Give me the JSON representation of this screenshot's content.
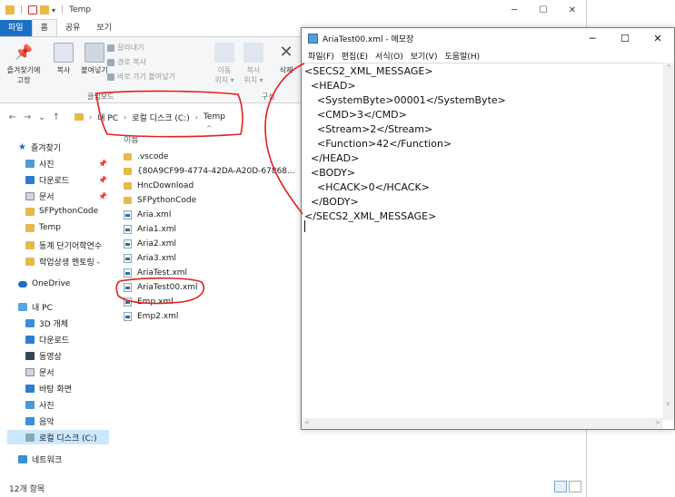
{
  "explorer": {
    "title": "Temp",
    "window_controls": {
      "minimize": "─",
      "maximize": "☐",
      "close": "✕"
    },
    "ribbon_tabs": [
      "파일",
      "홈",
      "공유",
      "보기"
    ],
    "ribbon": {
      "pin_label_1": "즐겨찾기에",
      "pin_label_2": "고정",
      "copy_label": "복사",
      "paste_label": "붙여넣기",
      "cut_label": "잘라내기",
      "copy_path_label": "경로 복사",
      "paste_shortcut_label": "바로 가기 붙여넣기",
      "move_label_1": "이동",
      "move_label_2": "위치 ▾",
      "copyto_label_1": "복사",
      "copyto_label_2": "위치 ▾",
      "delete_label": "삭제",
      "clipboard_group": "클립보드",
      "organize_group": "구성"
    },
    "address": {
      "crumbs": [
        "내 PC",
        "로컬 디스크 (C:)",
        "Temp"
      ]
    },
    "nav_buttons": {
      "back": "←",
      "forward": "→",
      "recent": "⌄",
      "up": "↑"
    },
    "nav_pane": {
      "quick_access": "즐겨찾기",
      "quick_items": [
        "사진",
        "다운로드",
        "문서",
        "SFPythonCode",
        "Temp",
        "동계 단기어학연수",
        "학업상생 멘토링 - "
      ],
      "onedrive": "OneDrive",
      "this_pc": "내 PC",
      "pc_items": [
        "3D 개체",
        "다운로드",
        "동영상",
        "문서",
        "바탕 화면",
        "사진",
        "음악",
        "로컬 디스크 (C:)"
      ],
      "network": "네트워크"
    },
    "file_list": {
      "column_name": "이름",
      "items": [
        {
          "name": ".vscode",
          "type": "folder"
        },
        {
          "name": "{80A9CF99-4774-42DA-A20D-67868...",
          "type": "folder"
        },
        {
          "name": "HncDownload",
          "type": "folder"
        },
        {
          "name": "SFPythonCode",
          "type": "folder"
        },
        {
          "name": "Aria.xml",
          "type": "xml"
        },
        {
          "name": "Aria1.xml",
          "type": "xml"
        },
        {
          "name": "Aria2.xml",
          "type": "xml"
        },
        {
          "name": "Aria3.xml",
          "type": "xml"
        },
        {
          "name": "AriaTest.xml",
          "type": "xml"
        },
        {
          "name": "AriaTest00.xml",
          "type": "xml"
        },
        {
          "name": "Emp.xml",
          "type": "xml"
        },
        {
          "name": "Emp2.xml",
          "type": "xml"
        }
      ]
    },
    "status": {
      "item_count": "12개 항목"
    }
  },
  "notepad": {
    "title": "AriaTest00.xml - 메모장",
    "window_controls": {
      "minimize": "─",
      "maximize": "☐",
      "close": "✕"
    },
    "menu": [
      "파일(F)",
      "편집(E)",
      "서식(O)",
      "보기(V)",
      "도움말(H)"
    ],
    "lines": [
      "<SECS2_XML_MESSAGE>",
      "  <HEAD>",
      "    <SystemByte>00001</SystemByte>",
      "    <CMD>3</CMD>",
      "    <Stream>2</Stream>",
      "    <Function>42</Function>",
      "  </HEAD>",
      "  <BODY>",
      "    <HCACK>0</HCACK>",
      "  </BODY>",
      "</SECS2_XML_MESSAGE>"
    ]
  },
  "colors": {
    "accent": "#1a6fc6",
    "selection": "#cce8ff",
    "folder": "#e8b84a",
    "annotation": "#e02020"
  }
}
